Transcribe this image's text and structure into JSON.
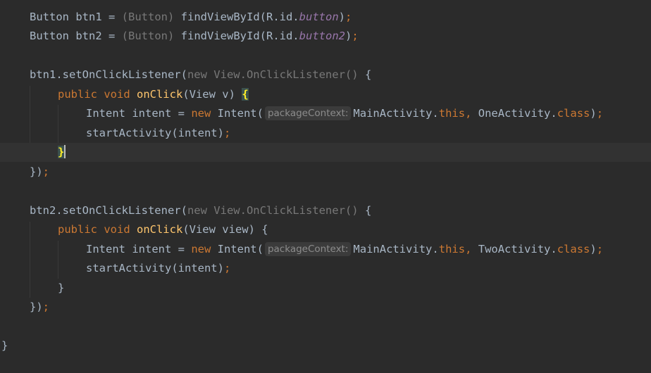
{
  "colors": {
    "background": "#2b2b2b",
    "current_line": "#323232",
    "text": "#a9b7c6",
    "keyword": "#cc7832",
    "method": "#ffc66d",
    "field": "#9876aa",
    "muted": "#787878",
    "hint_background": "#3b3b3b",
    "brace_match_background": "#3b514d",
    "brace_match_text": "#ffef28"
  },
  "code": {
    "l1": {
      "type": "Button ",
      "var": "btn1 = ",
      "cast_open": "(",
      "cast_type": "Button",
      "cast_close": ") ",
      "call": "findViewById(R.id.",
      "field": "button",
      "close": ")",
      "semi": ";"
    },
    "l2": {
      "type": "Button ",
      "var": "btn2 = ",
      "cast_open": "(",
      "cast_type": "Button",
      "cast_close": ") ",
      "call": "findViewById(R.id.",
      "field": "button2",
      "close": ")",
      "semi": ";"
    },
    "l4": {
      "call": "btn1.setOnClickListener(",
      "anon": "new View.OnClickListener() ",
      "brace": "{"
    },
    "l5": {
      "mods": "public void ",
      "method": "onClick",
      "params": "(View v) ",
      "brace": "{"
    },
    "l6": {
      "decl": "Intent intent = ",
      "kw_new": "new ",
      "ctor": "Intent(",
      "hint": "packageContext:",
      "arg1": "MainActivity.",
      "kw_this": "this",
      "comma": ", ",
      "arg2": "OneActivity.",
      "kw_class": "class",
      "close": ")",
      "semi": ";"
    },
    "l7": {
      "call": "startActivity(intent)",
      "semi": ";"
    },
    "l8": {
      "brace": "}"
    },
    "l9": {
      "close": "})",
      "semi": ";"
    },
    "l11": {
      "call": "btn2.setOnClickListener(",
      "anon": "new View.OnClickListener() ",
      "brace": "{"
    },
    "l12": {
      "mods": "public void ",
      "method": "onClick",
      "params": "(View view) ",
      "brace": "{"
    },
    "l13": {
      "decl": "Intent intent = ",
      "kw_new": "new ",
      "ctor": "Intent(",
      "hint": "packageContext:",
      "arg1": "MainActivity.",
      "kw_this": "this",
      "comma": ", ",
      "arg2": "TwoActivity.",
      "kw_class": "class",
      "close": ")",
      "semi": ";"
    },
    "l14": {
      "call": "startActivity(intent)",
      "semi": ";"
    },
    "l15": {
      "brace": "}"
    },
    "l16": {
      "close": "})",
      "semi": ";"
    },
    "l18": {
      "brace": "}"
    }
  }
}
